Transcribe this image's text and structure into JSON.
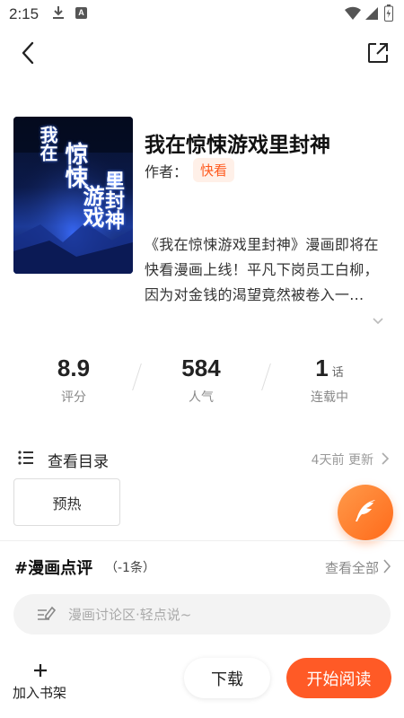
{
  "status_bar": {
    "time": "2:15",
    "a_badge": "A",
    "icons": [
      "download-icon",
      "a-badge-icon",
      "wifi-icon",
      "signal-icon",
      "battery-icon"
    ]
  },
  "nav": {
    "back_icon": "chevron-left-icon",
    "share_icon": "external-share-icon"
  },
  "comic": {
    "title": "我在惊悚游戏里封神",
    "author_label": "作者：",
    "author_name": "快看",
    "cover_text_lines": [
      "我在",
      "惊悚",
      "游戏",
      "里封神"
    ],
    "description": "《我在惊悚游戏里封神》漫画即将在快看漫画上线！平凡下岗员工白柳，因为对金钱的渴望竟然被卷入一..."
  },
  "stats": {
    "rating": {
      "value": "8.9",
      "label": "评分"
    },
    "popularity": {
      "value": "584",
      "label": "人气"
    },
    "chapters": {
      "value": "1",
      "unit": "话",
      "label": "连载中"
    }
  },
  "toc": {
    "label": "查看目录",
    "update_text": "4天前 更新",
    "chapter_button": "预热"
  },
  "comments": {
    "title": "#漫画点评",
    "count": "（-1条）",
    "view_all": "查看全部",
    "input_placeholder": "漫画讨论区·轻点说~"
  },
  "bottom_bar": {
    "add_shelf_label": "加入书架",
    "download_label": "下载",
    "read_label": "开始阅读"
  },
  "colors": {
    "accent": "#ff5a26",
    "author_tag_bg": "#fff0e8",
    "author_tag_text": "#ff5a1e",
    "fab_gradient_start": "#ff9a4a",
    "fab_gradient_end": "#ff6a1a"
  }
}
